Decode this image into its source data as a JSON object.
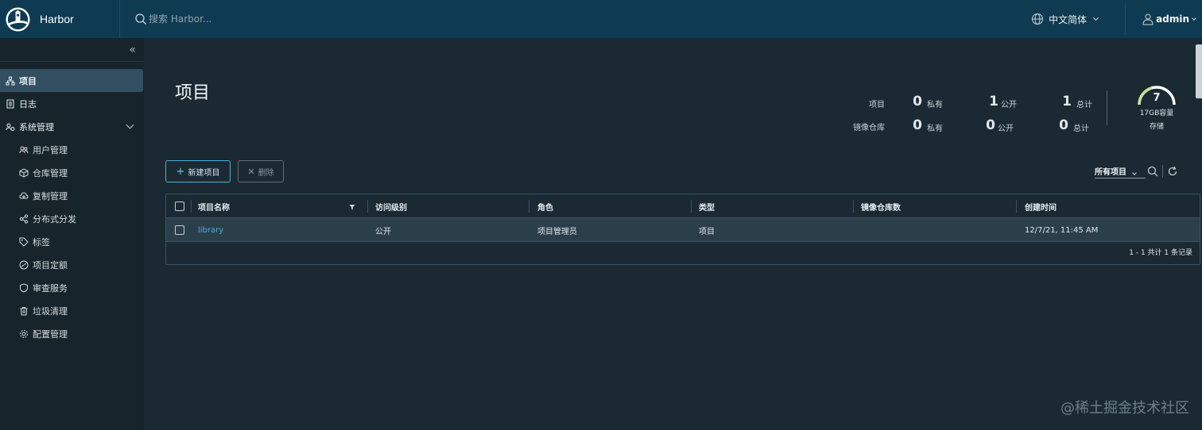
{
  "header": {
    "brand": "Harbor",
    "search_placeholder": "搜索 Harbor...",
    "language": "中文简体",
    "user": "admin"
  },
  "sidebar": {
    "items": [
      {
        "label": "项目",
        "icon": "projects-icon",
        "active": true
      },
      {
        "label": "日志",
        "icon": "logs-icon"
      },
      {
        "label": "系统管理",
        "icon": "admin-icon",
        "expanded": true
      }
    ],
    "sub_items": [
      {
        "label": "用户管理",
        "icon": "users-icon"
      },
      {
        "label": "仓库管理",
        "icon": "registry-icon"
      },
      {
        "label": "复制管理",
        "icon": "replication-icon"
      },
      {
        "label": "分布式分发",
        "icon": "distribution-icon"
      },
      {
        "label": "标签",
        "icon": "tag-icon"
      },
      {
        "label": "项目定额",
        "icon": "quota-icon"
      },
      {
        "label": "审查服务",
        "icon": "shield-icon"
      },
      {
        "label": "垃圾清理",
        "icon": "trash-icon"
      },
      {
        "label": "配置管理",
        "icon": "gear-icon"
      }
    ]
  },
  "main": {
    "title": "项目",
    "stats": {
      "projects_label": "项目",
      "repos_label": "镜像仓库",
      "private_word": "私有",
      "public_word": "公开",
      "total_word": "总计",
      "projects": {
        "private": "0",
        "public": "1",
        "total": "1"
      },
      "repos": {
        "private": "0",
        "public": "0",
        "total": "0"
      }
    },
    "storage": {
      "value": "7",
      "capacity": "17GB容量",
      "label": "存储",
      "used_fraction": 0.41
    },
    "buttons": {
      "new_project": "新建项目",
      "delete": "删除"
    },
    "filter": {
      "selected": "所有项目"
    },
    "table": {
      "columns": [
        "项目名称",
        "访问级别",
        "角色",
        "类型",
        "镜像仓库数",
        "创建时间"
      ],
      "rows": [
        {
          "name": "library",
          "access": "公开",
          "role": "项目管理员",
          "type": "项目",
          "repo_count": "",
          "created": "12/7/21, 11:45 AM"
        }
      ],
      "footer": "1 - 1 共计 1 条记录"
    }
  },
  "watermark": "@稀土掘金技术社区",
  "colors": {
    "header_bg": "#0f3b52",
    "sidebar_bg": "#17242b",
    "main_bg": "#1b2a32",
    "accent": "#49aedb",
    "gauge": "#c5e09a"
  }
}
